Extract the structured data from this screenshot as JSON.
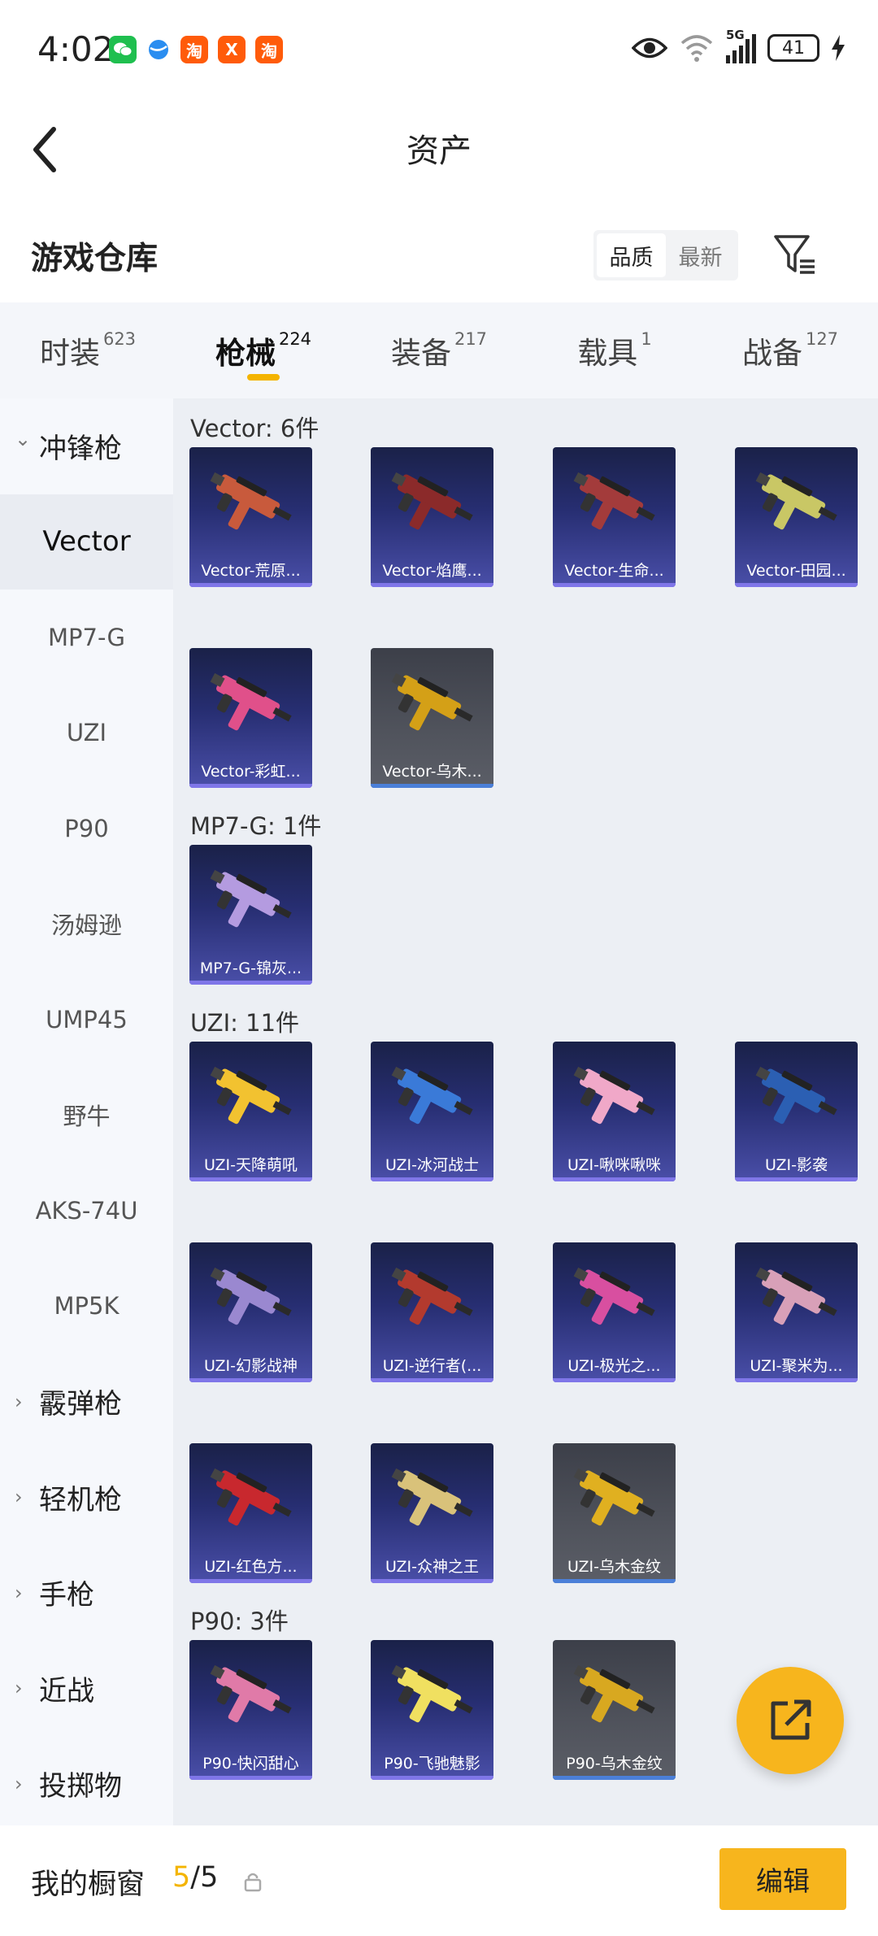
{
  "status_bar": {
    "time": "4:02",
    "network": "5G",
    "battery": "41",
    "apps": [
      "wechat-icon",
      "browser-icon",
      "taobao-icon",
      "app-icon",
      "taobao-icon"
    ],
    "app_glyph_tb": "淘",
    "app_glyph_x": "X"
  },
  "header": {
    "title": "资产"
  },
  "warehouse": {
    "title": "游戏仓库",
    "sort_options": [
      "品质",
      "最新"
    ],
    "sort_selected": "品质"
  },
  "tabs": [
    {
      "label": "时装",
      "count": "623",
      "active": false
    },
    {
      "label": "枪械",
      "count": "224",
      "active": true
    },
    {
      "label": "装备",
      "count": "217",
      "active": false
    },
    {
      "label": "载具",
      "count": "1",
      "active": false
    },
    {
      "label": "战备",
      "count": "127",
      "active": false
    }
  ],
  "sidebar": [
    {
      "label": "冲锋枪",
      "type": "group",
      "expanded": true
    },
    {
      "label": "Vector",
      "type": "item",
      "active": true
    },
    {
      "label": "MP7-G",
      "type": "item"
    },
    {
      "label": "UZI",
      "type": "item"
    },
    {
      "label": "P90",
      "type": "item"
    },
    {
      "label": "汤姆逊",
      "type": "item"
    },
    {
      "label": "UMP45",
      "type": "item"
    },
    {
      "label": "野牛",
      "type": "item"
    },
    {
      "label": "AKS-74U",
      "type": "item"
    },
    {
      "label": "MP5K",
      "type": "item"
    },
    {
      "label": "霰弹枪",
      "type": "group",
      "expanded": false
    },
    {
      "label": "轻机枪",
      "type": "group",
      "expanded": false
    },
    {
      "label": "手枪",
      "type": "group",
      "expanded": false
    },
    {
      "label": "近战",
      "type": "group",
      "expanded": false
    },
    {
      "label": "投掷物",
      "type": "group",
      "expanded": false
    }
  ],
  "sections": [
    {
      "title": "Vector: 6件",
      "items": [
        {
          "name": "Vector-荒原...",
          "gray": false,
          "color": "#c85a3c"
        },
        {
          "name": "Vector-焰鹰...",
          "gray": false,
          "color": "#8b2a2a"
        },
        {
          "name": "Vector-生命...",
          "gray": false,
          "color": "#a33b3b"
        },
        {
          "name": "Vector-田园...",
          "gray": false,
          "color": "#c9c765"
        },
        {
          "name": "Vector-彩虹...",
          "gray": false,
          "color": "#e0508a"
        },
        {
          "name": "Vector-乌木...",
          "gray": true,
          "color": "#d4a017"
        }
      ]
    },
    {
      "title": "MP7-G: 1件",
      "items": [
        {
          "name": "MP7-G-锦灰...",
          "gray": false,
          "color": "#b49be0"
        }
      ]
    },
    {
      "title": "UZI: 11件",
      "items": [
        {
          "name": "UZI-天降萌吼",
          "gray": false,
          "color": "#f2c230"
        },
        {
          "name": "UZI-冰河战士",
          "gray": false,
          "color": "#3a7ad8"
        },
        {
          "name": "UZI-啾咪啾咪",
          "gray": false,
          "color": "#f0a8c8"
        },
        {
          "name": "UZI-影袭",
          "gray": false,
          "color": "#2b5fb3"
        },
        {
          "name": "UZI-幻影战神",
          "gray": false,
          "color": "#9a88d0"
        },
        {
          "name": "UZI-逆行者(...",
          "gray": false,
          "color": "#b33a2e"
        },
        {
          "name": "UZI-极光之...",
          "gray": false,
          "color": "#d84fa0"
        },
        {
          "name": "UZI-聚米为...",
          "gray": false,
          "color": "#d8a0b8"
        },
        {
          "name": "UZI-红色方...",
          "gray": false,
          "color": "#c8282e"
        },
        {
          "name": "UZI-众神之王",
          "gray": false,
          "color": "#d9c27a"
        },
        {
          "name": "UZI-乌木金纹",
          "gray": true,
          "color": "#e0b020"
        }
      ]
    },
    {
      "title": "P90: 3件",
      "items": [
        {
          "name": "P90-快闪甜心",
          "gray": false,
          "color": "#e07aa8"
        },
        {
          "name": "P90-飞驰魅影",
          "gray": false,
          "color": "#f0e060"
        },
        {
          "name": "P90-乌木金纹",
          "gray": true,
          "color": "#d8a820"
        }
      ]
    }
  ],
  "showcase": {
    "label": "我的橱窗",
    "current": "5",
    "separator": "/",
    "total": "5"
  },
  "actions": {
    "edit": "编辑"
  },
  "accent_color": "#f4b400"
}
